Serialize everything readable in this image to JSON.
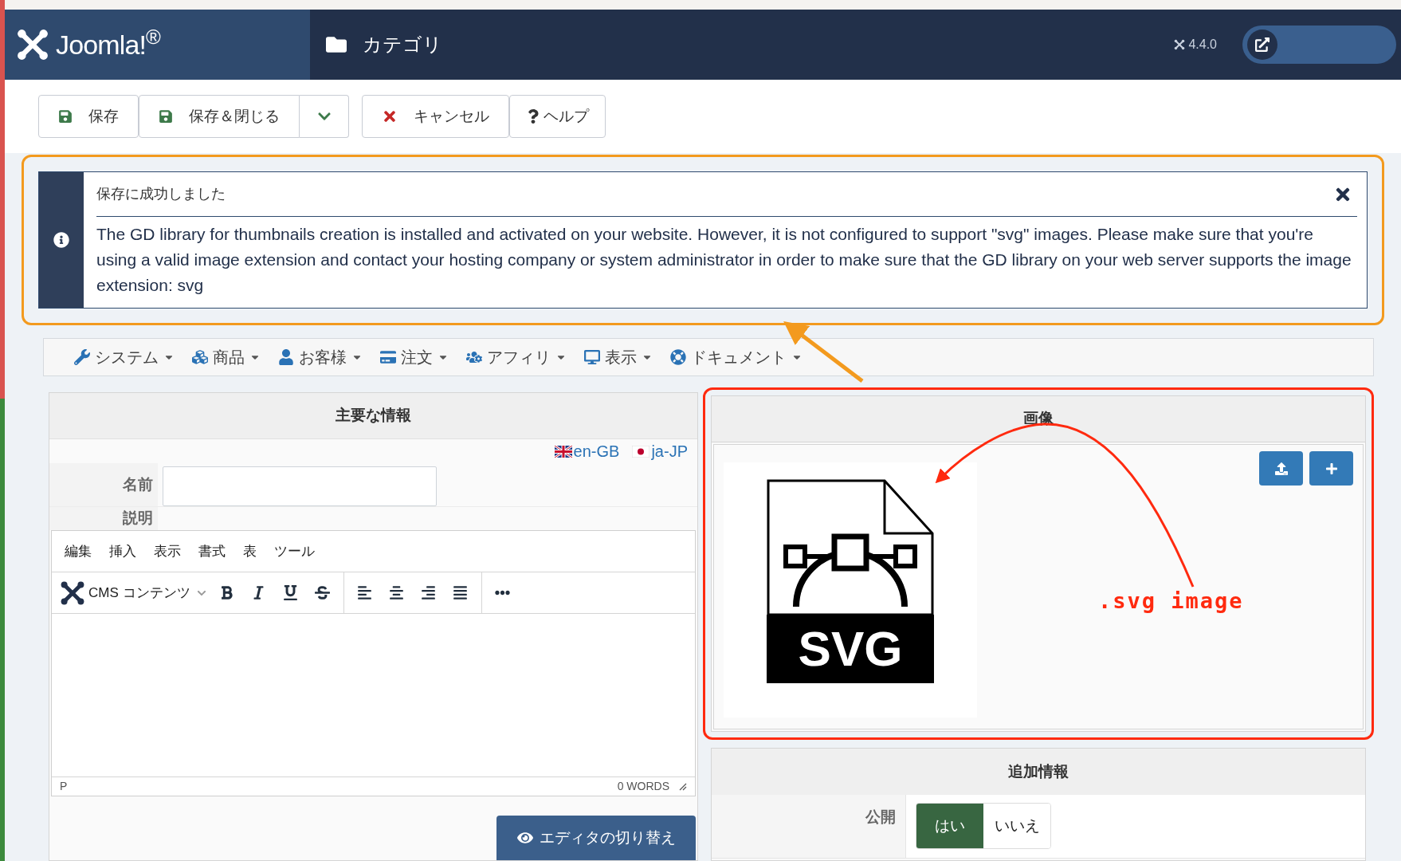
{
  "header": {
    "logo": "Joomla!$^{®}$",
    "title": "カテゴリ",
    "version": "4.4.0"
  },
  "toolbar": [
    {
      "kind": "save",
      "label": "保存"
    },
    {
      "kind": "save",
      "label": "保存＆閉じる"
    },
    {
      "kind": "dropdown"
    },
    {
      "kind": "cancel",
      "label": "キャンセル"
    },
    {
      "kind": "help",
      "label": "ヘルプ"
    }
  ],
  "alert": {
    "title": "保存に成功しました",
    "message": "The GD library for thumbnails creation is installed and activated on your website. However, it is not configured to support \"svg\" images. Please make sure that you're using a valid image extension and contact your hosting company or system administrator in order to make sure that the GD library on your web server supports the image extension: svg"
  },
  "menu": [
    {
      "kind": "wrench",
      "label": "システム"
    },
    {
      "kind": "cubes",
      "label": "商品"
    },
    {
      "kind": "user",
      "label": "お客様"
    },
    {
      "kind": "card",
      "label": "注文"
    },
    {
      "kind": "users",
      "label": "アフィリ"
    },
    {
      "kind": "desktop",
      "label": "表示"
    },
    {
      "kind": "lifebuoy",
      "label": "ドキュメント"
    }
  ],
  "main_panel": {
    "title": "主要な情報",
    "languages": [
      {
        "kind": "gb",
        "code": "en-GB"
      },
      {
        "kind": "jp",
        "code": "ja-JP"
      }
    ],
    "name_label": "名前",
    "description_label": "説明",
    "editor": {
      "menus": [
        "編集",
        "挿入",
        "表示",
        "書式",
        "表",
        "ツール"
      ],
      "format": "CMS コンテンツ",
      "tools": [
        {
          "kind": "bold"
        },
        {
          "kind": "italic"
        },
        {
          "kind": "underline"
        },
        {
          "kind": "strike"
        },
        {
          "kind": "sep"
        },
        {
          "kind": "left"
        },
        {
          "kind": "center"
        },
        {
          "kind": "right"
        },
        {
          "kind": "justify"
        },
        {
          "kind": "sep"
        },
        {
          "kind": "more"
        }
      ],
      "path": "P",
      "words": "0 WORDS"
    },
    "toggle_button": "エディタの切り替え"
  },
  "image_panel": {
    "title": "画像",
    "file_label": "SVG",
    "annotation": ".svg image"
  },
  "extra_panel": {
    "title": "追加情報",
    "rows": [
      {
        "label": "公開",
        "options": [
          {
            "label": "はい",
            "selected": true
          },
          {
            "label": "いいえ",
            "selected": false
          }
        ]
      }
    ]
  }
}
